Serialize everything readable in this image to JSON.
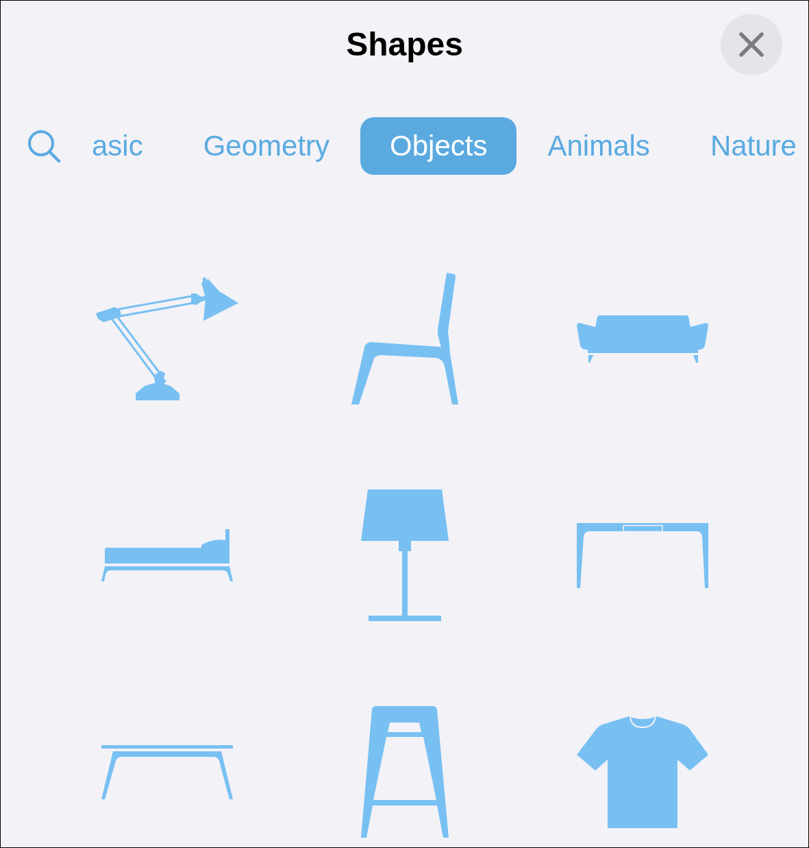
{
  "header": {
    "title": "Shapes"
  },
  "tabs": [
    {
      "label": "asic",
      "selected": false
    },
    {
      "label": "Geometry",
      "selected": false
    },
    {
      "label": "Objects",
      "selected": true
    },
    {
      "label": "Animals",
      "selected": false
    },
    {
      "label": "Nature",
      "selected": false
    }
  ],
  "shapes": [
    {
      "kind": "desklamp"
    },
    {
      "kind": "chair"
    },
    {
      "kind": "sofa"
    },
    {
      "kind": "bed"
    },
    {
      "kind": "tablelamp"
    },
    {
      "kind": "desk"
    },
    {
      "kind": "table"
    },
    {
      "kind": "stool"
    },
    {
      "kind": "shirt"
    }
  ]
}
